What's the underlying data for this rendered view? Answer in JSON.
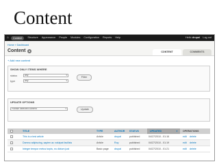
{
  "slide": {
    "title": "Content"
  },
  "toolbar": {
    "home_icon": "home-icon",
    "items": [
      "Content",
      "Structure",
      "Appearance",
      "People",
      "Modules",
      "Configuration",
      "Reports",
      "Help"
    ],
    "greeting_prefix": "Hello",
    "user": "drupal",
    "logout": "Log out"
  },
  "breadcrumb": "Home » Dashboard",
  "page": {
    "title": "Content",
    "settings_icon": "gear-icon"
  },
  "tabs": [
    {
      "label": "CONTENT",
      "active": true
    },
    {
      "label": "COMMENTS",
      "active": false
    }
  ],
  "add_content": "+ Add new content",
  "filter": {
    "legend": "SHOW ONLY ITEMS WHERE",
    "status_label": "status",
    "status_value": "any",
    "type_label": "type",
    "type_value": "any",
    "button": "Filter"
  },
  "update": {
    "legend": "UPDATE OPTIONS",
    "select_value": "Publish selected content",
    "button": "Update"
  },
  "table": {
    "headers": [
      "TITLE",
      "TYPE",
      "AUTHOR",
      "STATUS",
      "UPDATED",
      "OPERATIONS"
    ],
    "rows": [
      {
        "title": "This is a test article",
        "type": "Article",
        "author": "drupal",
        "status": "published",
        "updated": "04/27/2010 - 01:16",
        "edit": "edit",
        "delete": "delete"
      },
      {
        "title": "Damno adipiscing, sapien ac volutpat facilisis",
        "type": "Article",
        "author": "Roy",
        "status": "published",
        "updated": "04/27/2010 - 01:19",
        "edit": "edit",
        "delete": "delete"
      },
      {
        "title": "Integer tempor metus turpis, eu dictum just",
        "type": "Basic page",
        "author": "drupal",
        "status": "published",
        "updated": "04/27/2010 - 01:21",
        "edit": "edit",
        "delete": "delete"
      }
    ]
  }
}
